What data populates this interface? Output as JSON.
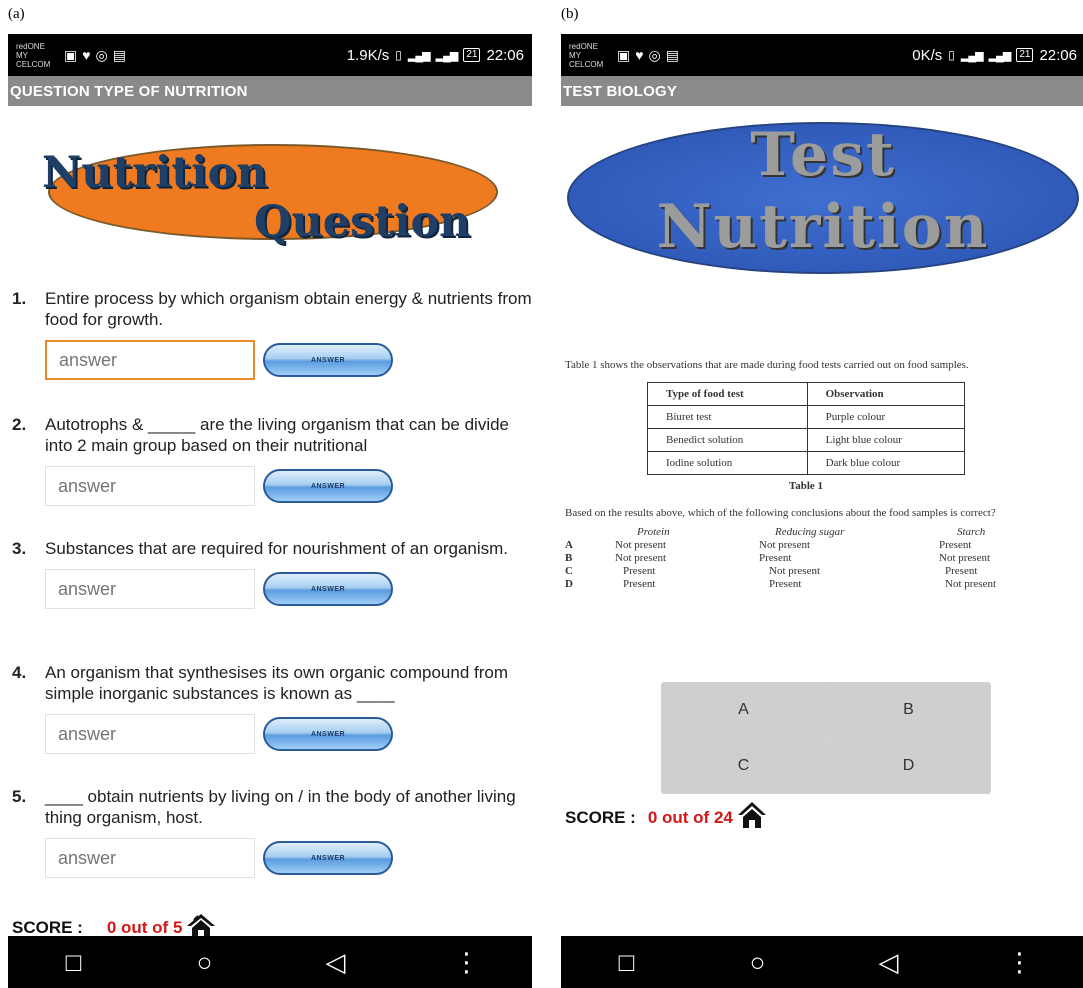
{
  "panels": {
    "a_label": "(a)",
    "b_label": "(b)"
  },
  "screen_a": {
    "status": {
      "carrier_line1": "redONE",
      "carrier_line2": "MY CELCOM",
      "speed": "1.9K/s",
      "battery": "21",
      "time": "22:06"
    },
    "app_title": "QUESTION TYPE OF NUTRITION",
    "logo": {
      "word1": "Nutrition",
      "word2": "Question"
    },
    "questions": [
      {
        "num": "1.",
        "text": "Entire process by which organism obtain energy & nutrients from food for growth.",
        "placeholder": "answer",
        "button": "ANSWER"
      },
      {
        "num": "2.",
        "text": "Autotrophs & _____ are the living organism that can be divide into 2 main group based on their nutritional",
        "placeholder": "answer",
        "button": "ANSWER"
      },
      {
        "num": "3.",
        "text": "Substances that are required for nourishment of an organism.",
        "placeholder": "answer",
        "button": "ANSWER"
      },
      {
        "num": "4.",
        "text": "An organism that synthesises its own organic compound from simple inorganic substances is known as ____",
        "placeholder": "answer",
        "button": "ANSWER"
      },
      {
        "num": "5.",
        "text": "____ obtain nutrients by living on / in the body of another living thing organism, host.",
        "placeholder": "answer",
        "button": "ANSWER"
      }
    ],
    "score_label": "SCORE :",
    "score_value": "0 out of 5"
  },
  "screen_b": {
    "status": {
      "carrier_line1": "redONE",
      "carrier_line2": "MY CELCOM",
      "speed": "0K/s",
      "battery": "21",
      "time": "22:06"
    },
    "app_title": "TEST BIOLOGY",
    "logo": {
      "word1": "Test",
      "word2": "Nutrition"
    },
    "question": {
      "intro": "Table 1 shows the observations that are made during food tests carried out on food samples.",
      "table_headers": [
        "Type of food test",
        "Observation"
      ],
      "table_rows": [
        [
          "Biuret test",
          "Purple colour"
        ],
        [
          "Benedict solution",
          "Light blue colour"
        ],
        [
          "Iodine solution",
          "Dark blue colour"
        ]
      ],
      "table_caption": "Table 1",
      "prompt": "Based on the results above, which of the following conclusions about the food samples is correct?",
      "option_headers": [
        "Protein",
        "Reducing sugar",
        "Starch"
      ],
      "options": [
        [
          "A",
          "Not present",
          "Not present",
          "Present"
        ],
        [
          "B",
          "Not present",
          "Present",
          "Not present"
        ],
        [
          "C",
          "Present",
          "Not present",
          "Present"
        ],
        [
          "D",
          "Present",
          "Present",
          "Not present"
        ]
      ]
    },
    "choices": [
      "A",
      "B",
      "C",
      "D"
    ],
    "score_label": "SCORE :",
    "score_value": "0 out of 24"
  },
  "colors": {
    "appbar": "#8a8a8a",
    "score_value": "#d41616",
    "logo_a_ellipse": "#f07a1f",
    "logo_b_ellipse": "#2a52b0",
    "focused_input_border": "#e8892b"
  },
  "icons": {
    "home": "home-icon",
    "nav_recents": "square-icon",
    "nav_home": "circle-icon",
    "nav_back": "triangle-back-icon",
    "nav_menu": "vertical-dots-icon"
  }
}
